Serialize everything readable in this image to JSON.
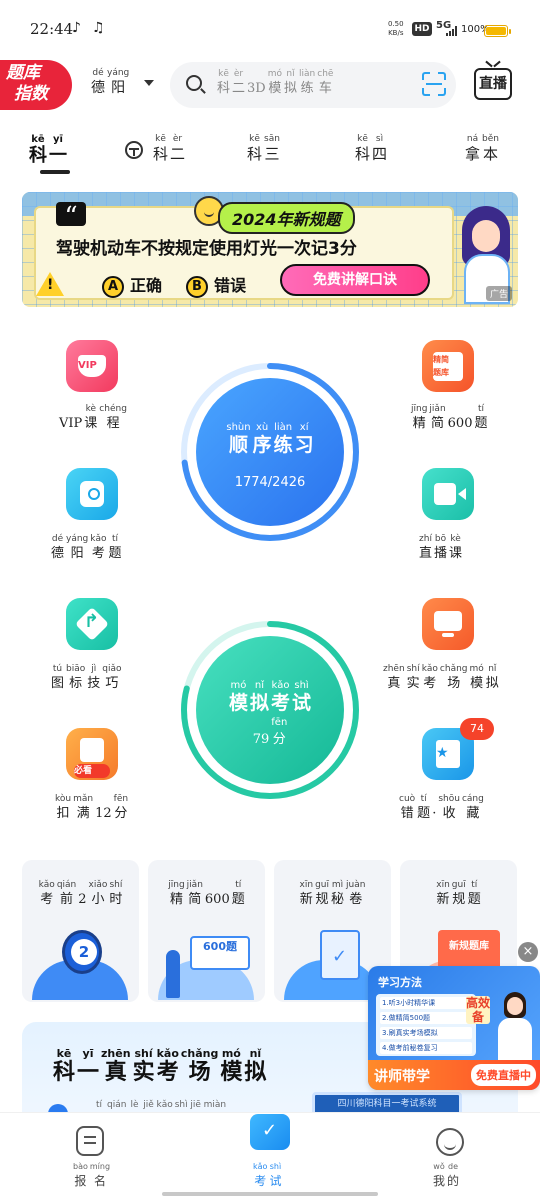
{
  "status_bar": {
    "time": "22:44",
    "net_speed_value": "0.50",
    "net_speed_unit": "KB/s",
    "hd_badge": "HD",
    "network": "5G",
    "battery": "100%"
  },
  "header": {
    "logo_line1": "题库",
    "logo_line2": "指数",
    "city": [
      {
        "py": "dé",
        "hz": "德"
      },
      {
        "py": "yáng",
        "hz": "阳"
      }
    ],
    "search_placeholder": [
      {
        "py": "kē",
        "hz": "科"
      },
      {
        "py": "èr",
        "hz": "二"
      },
      {
        "py": "",
        "hz": "3D"
      },
      {
        "py": "mó",
        "hz": "模"
      },
      {
        "py": "nǐ",
        "hz": "拟"
      },
      {
        "py": "liàn",
        "hz": "练"
      },
      {
        "py": "chē",
        "hz": "车"
      }
    ],
    "live_button": "直播"
  },
  "tabs": [
    {
      "words": [
        {
          "py": "kē",
          "hz": "科"
        },
        {
          "py": "yī",
          "hz": "一"
        }
      ],
      "active": true
    },
    {
      "words": [
        {
          "py": "kē",
          "hz": "科"
        },
        {
          "py": "èr",
          "hz": "二"
        }
      ]
    },
    {
      "words": [
        {
          "py": "kē",
          "hz": "科"
        },
        {
          "py": "sān",
          "hz": "三"
        }
      ]
    },
    {
      "words": [
        {
          "py": "kē",
          "hz": "科"
        },
        {
          "py": "sì",
          "hz": "四"
        }
      ]
    },
    {
      "words": [
        {
          "py": "ná",
          "hz": "拿"
        },
        {
          "py": "běn",
          "hz": "本"
        }
      ]
    }
  ],
  "banner": {
    "tag": "2024年新规题",
    "question": "驾驶机动车不按规定使用灯光一次记3分",
    "option_a_letter": "A",
    "option_a": "正确",
    "option_b_letter": "B",
    "option_b": "错误",
    "cta": "免费讲解口诀",
    "ad_tag": "广告"
  },
  "grid": {
    "vip": [
      {
        "py": "",
        "hz": "VIP"
      },
      {
        "py": "kè",
        "hz": "课"
      },
      {
        "py": "chéng",
        "hz": "程"
      }
    ],
    "jingjian": [
      {
        "py": "jīng",
        "hz": "精"
      },
      {
        "py": "jiǎn",
        "hz": "简"
      },
      {
        "py": "",
        "hz": "600"
      },
      {
        "py": "tí",
        "hz": "题"
      }
    ],
    "deyang": [
      {
        "py": "dé",
        "hz": "德"
      },
      {
        "py": "yáng",
        "hz": "阳"
      },
      {
        "py": "kǎo",
        "hz": "考"
      },
      {
        "py": "tí",
        "hz": "题"
      }
    ],
    "zhibo": [
      {
        "py": "zhí",
        "hz": "直"
      },
      {
        "py": "bō",
        "hz": "播"
      },
      {
        "py": "kè",
        "hz": "课"
      }
    ],
    "tubiao": [
      {
        "py": "tú",
        "hz": "图"
      },
      {
        "py": "biāo",
        "hz": "标"
      },
      {
        "py": "jì",
        "hz": "技"
      },
      {
        "py": "qiǎo",
        "hz": "巧"
      }
    ],
    "zhenshi": [
      {
        "py": "zhēn",
        "hz": "真"
      },
      {
        "py": "shí",
        "hz": "实"
      },
      {
        "py": "kǎo",
        "hz": "考"
      },
      {
        "py": "chǎng",
        "hz": "场"
      },
      {
        "py": "mó",
        "hz": "模"
      },
      {
        "py": "nǐ",
        "hz": "拟"
      }
    ],
    "kouman": [
      {
        "py": "kòu",
        "hz": "扣"
      },
      {
        "py": "mǎn",
        "hz": "满"
      },
      {
        "py": "",
        "hz": "12"
      },
      {
        "py": "fēn",
        "hz": "分"
      }
    ],
    "must_see": "必看",
    "cuoti": [
      {
        "py": "cuò",
        "hz": "错"
      },
      {
        "py": "tí",
        "hz": "题"
      },
      {
        "py": "",
        "hz": "·"
      },
      {
        "py": "shōu",
        "hz": "收"
      },
      {
        "py": "cáng",
        "hz": "藏"
      }
    ],
    "cuoti_badge": "74"
  },
  "sequential": {
    "words": [
      {
        "py": "shùn",
        "hz": "顺"
      },
      {
        "py": "xù",
        "hz": "序"
      },
      {
        "py": "liàn",
        "hz": "练"
      },
      {
        "py": "xí",
        "hz": "习"
      }
    ],
    "progress_text": "1774/2426",
    "progress_fraction": 0.73
  },
  "mock": {
    "words": [
      {
        "py": "mó",
        "hz": "模"
      },
      {
        "py": "nǐ",
        "hz": "拟"
      },
      {
        "py": "kǎo",
        "hz": "考"
      },
      {
        "py": "shì",
        "hz": "试"
      }
    ],
    "score": [
      {
        "py": "",
        "hz": "79"
      },
      {
        "py": "fēn",
        "hz": "分"
      }
    ],
    "score_fraction": 0.79
  },
  "cards": [
    {
      "words": [
        {
          "py": "kǎo",
          "hz": "考"
        },
        {
          "py": "qián",
          "hz": "前"
        },
        {
          "py": "",
          "hz": "2"
        },
        {
          "py": "xiǎo",
          "hz": "小"
        },
        {
          "py": "shí",
          "hz": "时"
        }
      ]
    },
    {
      "words": [
        {
          "py": "jīng",
          "hz": "精"
        },
        {
          "py": "jiǎn",
          "hz": "简"
        },
        {
          "py": "",
          "hz": "600"
        },
        {
          "py": "tí",
          "hz": "题"
        }
      ],
      "illustration_text": "600题"
    },
    {
      "words": [
        {
          "py": "xīn",
          "hz": "新"
        },
        {
          "py": "guī",
          "hz": "规"
        },
        {
          "py": "mì",
          "hz": "秘"
        },
        {
          "py": "juàn",
          "hz": "卷"
        }
      ]
    },
    {
      "words": [
        {
          "py": "xīn",
          "hz": "新"
        },
        {
          "py": "guī",
          "hz": "规"
        },
        {
          "py": "tí",
          "hz": "题"
        }
      ],
      "illustration_text": "新规题库"
    }
  ],
  "mock_exam_card": {
    "title": [
      {
        "py": "kē",
        "hz": "科"
      },
      {
        "py": "yī",
        "hz": "一"
      },
      {
        "py": "zhēn",
        "hz": "真"
      },
      {
        "py": "shí",
        "hz": "实"
      },
      {
        "py": "kǎo",
        "hz": "考"
      },
      {
        "py": "chǎng",
        "hz": "场"
      },
      {
        "py": "mó",
        "hz": "模"
      },
      {
        "py": "nǐ",
        "hz": "拟"
      }
    ],
    "subline": [
      {
        "py": "tí",
        "hz": "提"
      },
      {
        "py": "qián",
        "hz": "前"
      },
      {
        "py": "lè",
        "hz": "了"
      },
      {
        "py": "jiě",
        "hz": "解"
      },
      {
        "py": "kǎo",
        "hz": "考"
      },
      {
        "py": "shì",
        "hz": "试"
      },
      {
        "py": "jiē",
        "hz": "界"
      },
      {
        "py": "miàn",
        "hz": "面"
      }
    ],
    "preview_text": "四川德阳科目一考试系统"
  },
  "promo": {
    "title": "学习方法",
    "steps": [
      "1.听3小时精华课",
      "2.做精简500题",
      "3.刷真实考场模拟",
      "4.做考前秘卷复习"
    ],
    "highlight": "高效备",
    "left_label": "讲师带学",
    "right_label": "免费直播中",
    "close": "×"
  },
  "bottom_nav": [
    {
      "words": [
        {
          "py": "bào",
          "hz": "报"
        },
        {
          "py": "míng",
          "hz": "名"
        }
      ]
    },
    {
      "words": [
        {
          "py": "kǎo",
          "hz": "考"
        },
        {
          "py": "shì",
          "hz": "试"
        }
      ],
      "active": true
    },
    {
      "words": [
        {
          "py": "wǒ",
          "hz": "我"
        },
        {
          "py": "de",
          "hz": "的"
        }
      ]
    }
  ],
  "colors": {
    "accent": "#2a8cf0",
    "sequential_circle": "#2f86f5",
    "mock_circle": "#1fc9a8",
    "logo_red": "#e8243a",
    "badge_red": "#f5432a"
  }
}
